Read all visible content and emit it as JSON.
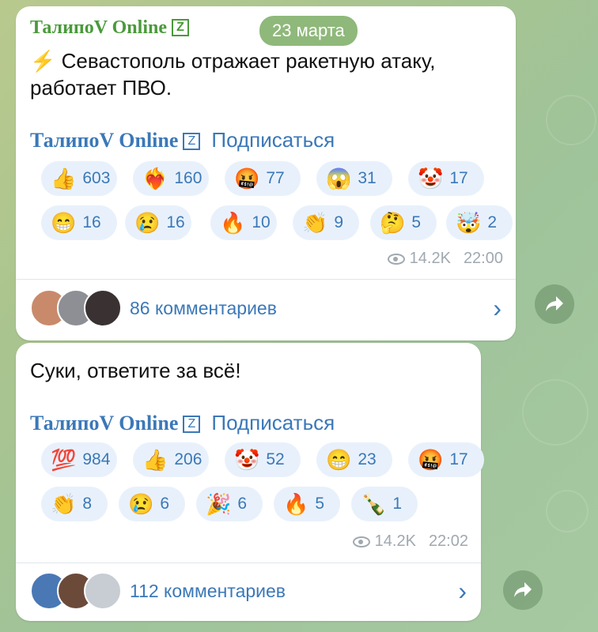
{
  "date_pill": "23 марта",
  "messages": [
    {
      "channel": "ТалипоV Online",
      "channel_badge": "Z",
      "text_icon": "⚡",
      "text_line1": "Севастополь отражает ракетную атаку,",
      "text_line2": "работает ПВО.",
      "subscribe_channel": "ТалипоV Online",
      "subscribe_badge": "Z",
      "subscribe_label": "Подписаться",
      "reactions_row1": [
        {
          "emoji": "👍",
          "count": "603"
        },
        {
          "emoji": "❤️‍🔥",
          "count": "160"
        },
        {
          "emoji": "🤬",
          "count": "77"
        },
        {
          "emoji": "😱",
          "count": "31"
        },
        {
          "emoji": "🤡",
          "count": "17"
        }
      ],
      "reactions_row2": [
        {
          "emoji": "😁",
          "count": "16"
        },
        {
          "emoji": "😢",
          "count": "16"
        },
        {
          "emoji": "🔥",
          "count": "10"
        },
        {
          "emoji": "👏",
          "count": "9"
        },
        {
          "emoji": "🤔",
          "count": "5"
        },
        {
          "emoji": "🤯",
          "count": "2"
        }
      ],
      "views": "14.2K",
      "time": "22:00",
      "comments": "86 комментариев",
      "avatar_colors": [
        "#c98a6b",
        "#8d8f95",
        "#3a3232"
      ]
    },
    {
      "text_line1": "Суки, ответите за всё!",
      "subscribe_channel": "ТалипоV Online",
      "subscribe_badge": "Z",
      "subscribe_label": "Подписаться",
      "reactions_row1": [
        {
          "emoji": "💯",
          "count": "984"
        },
        {
          "emoji": "👍",
          "count": "206"
        },
        {
          "emoji": "🤡",
          "count": "52"
        },
        {
          "emoji": "😁",
          "count": "23"
        },
        {
          "emoji": "🤬",
          "count": "17"
        }
      ],
      "reactions_row2": [
        {
          "emoji": "👏",
          "count": "8"
        },
        {
          "emoji": "😢",
          "count": "6"
        },
        {
          "emoji": "🎉",
          "count": "6"
        },
        {
          "emoji": "🔥",
          "count": "5"
        },
        {
          "emoji": "🍾",
          "count": "1"
        }
      ],
      "views": "14.2K",
      "time": "22:02",
      "comments": "112 комментариев",
      "avatar_colors": [
        "#4a78b5",
        "#6b4a3a",
        "#c7cdd3"
      ]
    }
  ],
  "icons": {
    "views": "eye-icon",
    "share": "share-arrow-icon",
    "chevron": "chevron-right-icon"
  },
  "colors": {
    "accent": "#3b78b8",
    "channel_green": "#4a9a3a",
    "reaction_bg": "#e8f1fb",
    "date_pill_bg": "#8fb87b"
  }
}
